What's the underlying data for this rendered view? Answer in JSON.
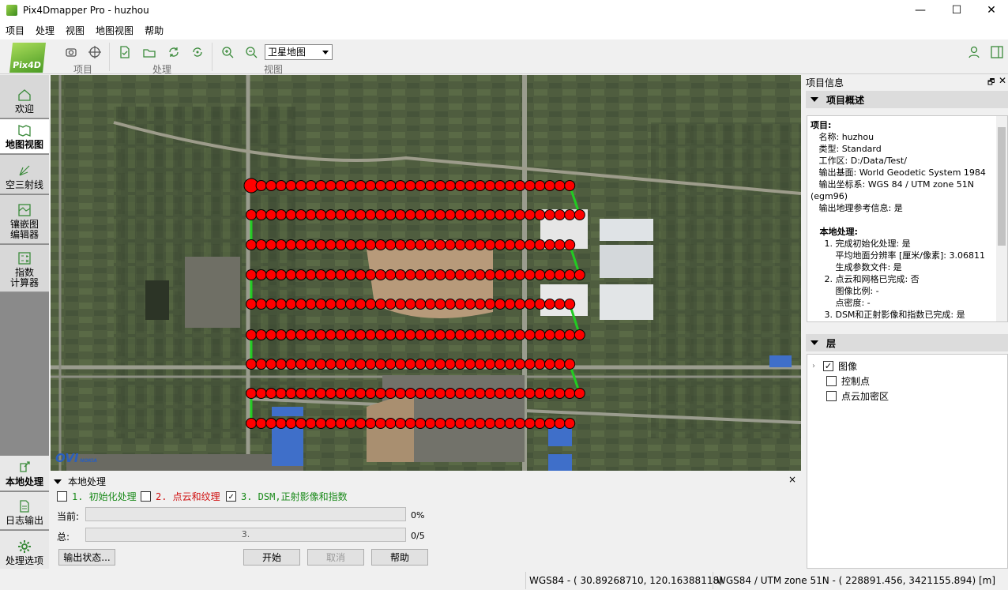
{
  "window": {
    "title": "Pix4Dmapper Pro - huzhou",
    "minimize": "—",
    "maximize": "☐",
    "close": "✕"
  },
  "menu": [
    "项目",
    "处理",
    "视图",
    "地图视图",
    "帮助"
  ],
  "toolbar": {
    "logo": "Pix4D",
    "groups": [
      "项目",
      "处理",
      "视图"
    ],
    "map_type": "卫星地图"
  },
  "sidebar": {
    "items": [
      {
        "label": "欢迎",
        "icon": "home-icon"
      },
      {
        "label": "地图视图",
        "icon": "map-icon"
      },
      {
        "label": "空三射线",
        "icon": "ray-icon"
      },
      {
        "label": "镶嵌图\n编辑器",
        "icon": "mosaic-icon"
      },
      {
        "label": "指数\n计算器",
        "icon": "calculator-icon"
      }
    ],
    "bottom": [
      {
        "label": "本地处理",
        "icon": "process-icon"
      },
      {
        "label": "日志输出",
        "icon": "log-icon"
      },
      {
        "label": "处理选项",
        "icon": "gear-icon"
      }
    ]
  },
  "map": {
    "logo": "OVI",
    "logo_sub": "NOKIA"
  },
  "processing": {
    "title": "本地处理",
    "close": "×",
    "steps": [
      {
        "label": "1. 初始化处理",
        "checked": false,
        "color": "#1a8a1a"
      },
      {
        "label": "2. 点云和纹理",
        "checked": false,
        "color": "#d01010"
      },
      {
        "label": "3. DSM,正射影像和指数",
        "checked": true,
        "color": "#1a8a1a"
      }
    ],
    "current_label": "当前:",
    "current_value": "0%",
    "total_label": "总:",
    "total_bar_text": "3.",
    "total_value": "0/5",
    "buttons": {
      "output_status": "输出状态...",
      "start": "开始",
      "cancel": "取消",
      "help": "帮助"
    }
  },
  "project_info": {
    "title": "项目信息",
    "float": "🗗",
    "close": "✕",
    "overview_title": "项目概述",
    "lines": [
      "项目:",
      "   名称: huzhou",
      "   类型: Standard",
      "   工作区: D:/Data/Test/",
      "   输出基面: World Geodetic System 1984",
      "   输出坐标系: WGS 84 / UTM zone 51N",
      "(egm96)",
      "   输出地理参考信息: 是",
      "",
      "   本地处理:",
      "     1. 完成初始化处理: 是",
      "         平均地面分辨率 [厘米/像素]: 3.06811",
      "         生成参数文件: 是",
      "     2. 点云和网格已完成: 否",
      "         图像比例: -",
      "         点密度: -",
      "     3. DSM和正射影像和指数已完成: 是"
    ],
    "layers_title": "层",
    "layers": [
      {
        "label": "图像",
        "checked": true
      },
      {
        "label": "控制点",
        "checked": false
      },
      {
        "label": "点云加密区",
        "checked": false
      }
    ]
  },
  "status": {
    "wgs": "WGS84 - ( 30.89268710,  120.16388118)",
    "utm": "WGS84 / UTM zone 51N - (    228891.456,    3421155.894) [m]"
  },
  "colors": {
    "flight_point": "#ff0000",
    "flight_line": "#22cc22"
  }
}
